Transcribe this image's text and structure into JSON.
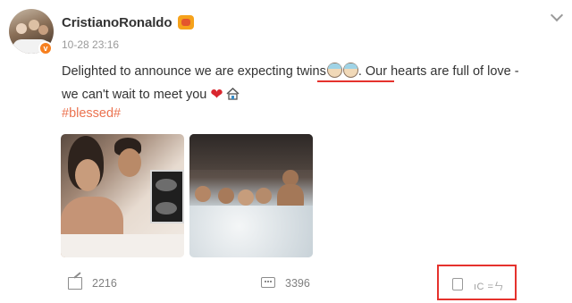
{
  "post": {
    "author": "CristianoRonaldo",
    "timestamp": "10-28 23:16",
    "text_part1": "Delighted to announce we are expecting ",
    "twins_word": "twins",
    "text_part2": ". Our hearts are full of love -",
    "text_line2": "we can't wait to meet you",
    "hashtag": "#blessed#"
  },
  "actions": {
    "share_count": "2216",
    "comment_count": "3396",
    "like_count": "ıC =ㄣ"
  },
  "icons": {
    "verified": "verified-badge-icon",
    "member": "member-badge-icon",
    "more": "chevron-down-icon",
    "share": "share-icon",
    "comment": "comment-icon",
    "like": "thumbs-up-icon",
    "baby": "baby-emoji-icon",
    "heart": "heart-emoji-icon",
    "house": "house-emoji-icon"
  },
  "colors": {
    "accent_orange": "#eb7350",
    "highlight_red": "#e5322d",
    "verified_orange": "#f7801f"
  }
}
